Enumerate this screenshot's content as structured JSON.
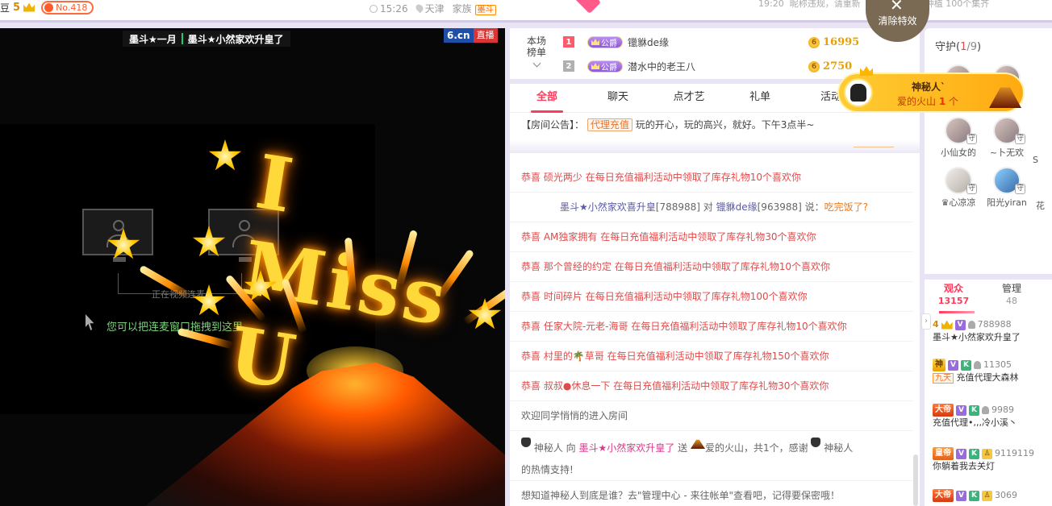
{
  "topbar": {
    "left_prefix": "豆",
    "user_level": "5",
    "no_badge": "No.418",
    "time": "15:26",
    "city": "天津",
    "family_label": "家族",
    "family_tag": "墨斗",
    "right_time": "19:20",
    "right_text": "昵称违规，请重新",
    "right_text2": "免费猫司美业种植 100个集齐"
  },
  "video": {
    "title_a": "墨斗★一月",
    "title_b": "墨斗★小然家欢升皇了",
    "logo": "6.cn",
    "live": "直播",
    "pk_status": "正在视频连麦",
    "pk_hint": "您可以把连麦窗口拖拽到这里",
    "effect_text": "I Miss U"
  },
  "rank": {
    "label": "本场榜单",
    "rows": [
      {
        "rank": "1",
        "title": "公爵",
        "name": "镴貅de缘",
        "coins": "16995",
        "color": "#ff5a6a"
      },
      {
        "rank": "2",
        "title": "公爵",
        "name": "潜水中的老王八",
        "coins": "2750",
        "color": "#b0b0b0"
      }
    ]
  },
  "chat": {
    "tabs": [
      "全部",
      "聊天",
      "点才艺",
      "礼单",
      "活动"
    ],
    "active_tab": 0,
    "notice_label": "【房间公告】：",
    "notice_agent": "代理充值",
    "notice_text": "玩的开心，玩的高兴，就好。下午3点半~",
    "messages": [
      {
        "prefix": "恭喜",
        "user": "硕光两少",
        "text": "在每日充值福利活动中领取了库存礼物10个喜欢你"
      },
      {
        "user": "墨斗★小然家欢喜升皇",
        "uid": "[788988]",
        "to": "对",
        "target": "镴貅de缘",
        "tid": "[963988]",
        "say": "说：",
        "content": "吃完饭了?"
      },
      {
        "prefix": "恭喜",
        "user": "AM独家拥有",
        "text": "在每日充值福利活动中领取了库存礼物30个喜欢你"
      },
      {
        "prefix": "恭喜",
        "user": "那个曾经的约定",
        "text": "在每日充值福利活动中领取了库存礼物10个喜欢你"
      },
      {
        "prefix": "恭喜",
        "user": "时间碎片",
        "text": "在每日充值福利活动中领取了库存礼物100个喜欢你"
      },
      {
        "prefix": "恭喜",
        "user": "任家大院-元老-海哥",
        "text": "在每日充值福利活动中领取了库存礼物10个喜欢你"
      },
      {
        "prefix": "恭喜",
        "user": "村里的🌴草哥",
        "text": "在每日充值福利活动中领取了库存礼物150个喜欢你"
      },
      {
        "prefix": "恭喜",
        "user": "叔叔●休息一下",
        "text": "在每日充值福利活动中领取了库存礼物30个喜欢你"
      },
      {
        "text": "欢迎同学悄悄的进入房间"
      },
      {
        "sender": "神秘人",
        "action": "向",
        "receiver": "墨斗★小然家欢升皇了",
        "send": "送",
        "gift": "爱的火山，共1个，感谢",
        "sender2": "神秘人",
        "thanks": "的热情支持!"
      },
      {
        "text": "想知道神秘人到底是谁？去\"管理中心 - 来往帐单\"查看吧，记得要保密哦！"
      }
    ]
  },
  "effects": {
    "clear_label": "清除特效",
    "banner_name": "神秘人`",
    "banner_gift": "爱的火山",
    "banner_count": "1",
    "banner_unit": "个"
  },
  "guard": {
    "title": "守护",
    "count": "1",
    "total": "/9",
    "tag": "守",
    "members": [
      "小仙女的",
      "~卜无欢",
      "♛心凉凉",
      "阳光yiran",
      "S",
      "花"
    ]
  },
  "audience": {
    "tabs": [
      {
        "label": "观众",
        "count": "13157"
      },
      {
        "label": "管理",
        "count": "48"
      }
    ],
    "users": [
      {
        "level": "4",
        "id": "788988",
        "name": "墨斗★小然家欢升皇了"
      },
      {
        "badge": "神",
        "id": "11305",
        "extra": "九天",
        "name": "充值代理大森林"
      },
      {
        "badge": "大帝",
        "id": "9989",
        "name": "充值代理•,,,冷小溪丶"
      },
      {
        "badge": "皇帝",
        "id": "9119119",
        "name": "你躺着我去关灯"
      },
      {
        "badge": "大帝",
        "id": "3069",
        "name": ""
      }
    ]
  },
  "colors": {
    "accent": "#ff3a5a",
    "coin": "#e7a000",
    "gift_link": "#e24a4a"
  }
}
